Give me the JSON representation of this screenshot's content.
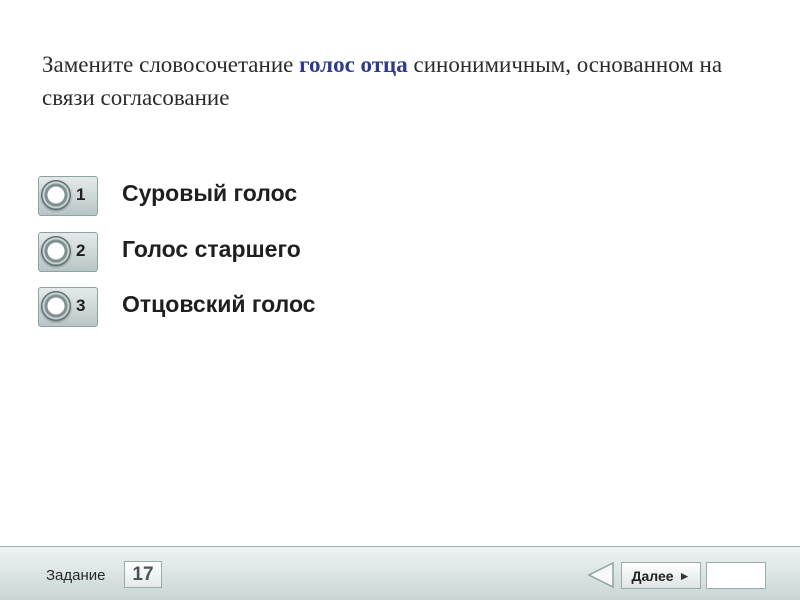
{
  "question": {
    "before": "Замените словосочетание ",
    "highlight": "голос отца",
    "after": " синонимичным, основанном на связи согласование"
  },
  "options": [
    {
      "number": "1",
      "text": "Суровый голос"
    },
    {
      "number": "2",
      "text": "Голос старшего"
    },
    {
      "number": "3",
      "text": "Отцовский голос"
    }
  ],
  "footer": {
    "task_label": "Задание",
    "task_number": "17",
    "next_label": "Далее",
    "next_icon": "►",
    "back_icon": "triangle-left-icon"
  }
}
